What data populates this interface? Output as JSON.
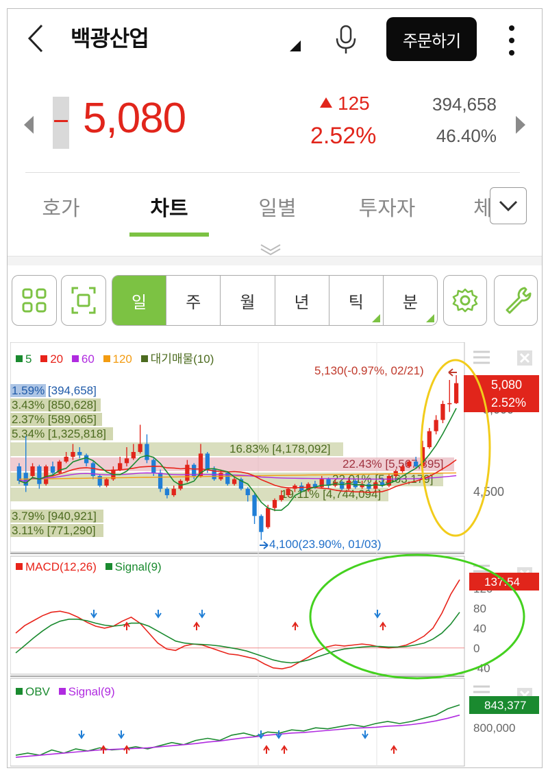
{
  "header": {
    "title": "백광산업",
    "order_button": "주문하기"
  },
  "quote": {
    "price": "5,080",
    "change": "125",
    "change_pct": "2.52%",
    "volume": "394,658",
    "turnover": "46.40%"
  },
  "tabs": [
    {
      "label": "호가"
    },
    {
      "label": "차트"
    },
    {
      "label": "일별"
    },
    {
      "label": "투자자"
    },
    {
      "label": "체"
    }
  ],
  "periods": [
    {
      "label": "일"
    },
    {
      "label": "주"
    },
    {
      "label": "월"
    },
    {
      "label": "년"
    },
    {
      "label": "틱"
    },
    {
      "label": "분"
    }
  ],
  "colors": {
    "up": "#e1251b",
    "down": "#1f7ed6",
    "accent": "#7cc243",
    "ma5": "#1a8a2f",
    "ma20": "#e8231a",
    "ma60": "#b02be0",
    "ma120": "#f39c12",
    "vp": "#4c6b1f"
  },
  "price_chart": {
    "legend": [
      {
        "label": "5",
        "color": "#1a8a2f"
      },
      {
        "label": "20",
        "color": "#e8231a"
      },
      {
        "label": "60",
        "color": "#b02be0"
      },
      {
        "label": "120",
        "color": "#f39c12"
      },
      {
        "label": "대기매물(10)",
        "color": "#4c6b1f"
      }
    ],
    "high_label": "5,130(-0.97%, 02/21)",
    "low_label": "4,100(23.90%, 01/03)",
    "axis_label": "4,500",
    "axis_label_top": "5,000",
    "tag_price": "5,080",
    "tag_pct": "2.52%",
    "volume_profile": [
      {
        "label": "1.59% [394,658]",
        "highlight": "blue"
      },
      {
        "label": "3.43% [850,628]"
      },
      {
        "label": "2.37% [589,065]"
      },
      {
        "label": "5.34% [1,325,818]"
      },
      {
        "label": "16.83% [4,178,092]"
      },
      {
        "label": "22.43% [5,567,895]",
        "highlight": "pink"
      },
      {
        "label": "22.01% [5,463,179]"
      },
      {
        "label": "19.11% [4,744,094]"
      },
      {
        "label": "3.79% [940,921]"
      },
      {
        "label": "3.11% [771,290]"
      }
    ]
  },
  "macd_chart": {
    "legend": [
      {
        "label": "MACD(12,26)",
        "color": "#e8231a"
      },
      {
        "label": "Signal(9)",
        "color": "#1a8a2f"
      }
    ],
    "y_ticks": [
      "120",
      "80",
      "40",
      "0",
      "-40"
    ],
    "tag": "137.54"
  },
  "obv_chart": {
    "legend": [
      {
        "label": "OBV",
        "color": "#1a8a2f"
      },
      {
        "label": "Signal(9)",
        "color": "#b02be0"
      }
    ],
    "y_ticks": [
      "800,000"
    ],
    "tag": "843,377"
  },
  "chart_data": [
    {
      "type": "candlestick",
      "title": "",
      "ylim": [
        4050,
        5250
      ],
      "candles": [
        {
          "o": 4560,
          "c": 4470,
          "h": 4580,
          "l": 4450
        },
        {
          "o": 4520,
          "c": 4440,
          "h": 4750,
          "l": 4400
        },
        {
          "o": 4500,
          "c": 4560,
          "h": 4580,
          "l": 4490
        },
        {
          "o": 4560,
          "c": 4450,
          "h": 4570,
          "l": 4420
        },
        {
          "o": 4450,
          "c": 4560,
          "h": 4570,
          "l": 4440
        },
        {
          "o": 4560,
          "c": 4520,
          "h": 4590,
          "l": 4510
        },
        {
          "o": 4520,
          "c": 4590,
          "h": 4600,
          "l": 4510
        },
        {
          "o": 4590,
          "c": 4620,
          "h": 4650,
          "l": 4580
        },
        {
          "o": 4620,
          "c": 4650,
          "h": 4700,
          "l": 4600
        },
        {
          "o": 4650,
          "c": 4630,
          "h": 4680,
          "l": 4610
        },
        {
          "o": 4630,
          "c": 4580,
          "h": 4640,
          "l": 4560
        },
        {
          "o": 4580,
          "c": 4500,
          "h": 4590,
          "l": 4480
        },
        {
          "o": 4500,
          "c": 4440,
          "h": 4510,
          "l": 4430
        },
        {
          "o": 4440,
          "c": 4480,
          "h": 4490,
          "l": 4430
        },
        {
          "o": 4480,
          "c": 4540,
          "h": 4560,
          "l": 4470
        },
        {
          "o": 4540,
          "c": 4580,
          "h": 4620,
          "l": 4530
        },
        {
          "o": 4580,
          "c": 4610,
          "h": 4680,
          "l": 4560
        },
        {
          "o": 4610,
          "c": 4650,
          "h": 4700,
          "l": 4600
        },
        {
          "o": 4650,
          "c": 4700,
          "h": 4820,
          "l": 4640
        },
        {
          "o": 4700,
          "c": 4600,
          "h": 4760,
          "l": 4580
        },
        {
          "o": 4600,
          "c": 4520,
          "h": 4610,
          "l": 4500
        },
        {
          "o": 4520,
          "c": 4420,
          "h": 4540,
          "l": 4400
        },
        {
          "o": 4420,
          "c": 4380,
          "h": 4430,
          "l": 4360
        },
        {
          "o": 4380,
          "c": 4420,
          "h": 4440,
          "l": 4370
        },
        {
          "o": 4420,
          "c": 4470,
          "h": 4480,
          "l": 4410
        },
        {
          "o": 4470,
          "c": 4570,
          "h": 4600,
          "l": 4460
        },
        {
          "o": 4570,
          "c": 4500,
          "h": 4580,
          "l": 4480
        },
        {
          "o": 4500,
          "c": 4640,
          "h": 4700,
          "l": 4490
        },
        {
          "o": 4640,
          "c": 4540,
          "h": 4650,
          "l": 4520
        },
        {
          "o": 4540,
          "c": 4480,
          "h": 4560,
          "l": 4470
        },
        {
          "o": 4480,
          "c": 4520,
          "h": 4540,
          "l": 4470
        },
        {
          "o": 4520,
          "c": 4450,
          "h": 4530,
          "l": 4440
        },
        {
          "o": 4450,
          "c": 4480,
          "h": 4500,
          "l": 4440
        },
        {
          "o": 4480,
          "c": 4420,
          "h": 4490,
          "l": 4410
        },
        {
          "o": 4420,
          "c": 4380,
          "h": 4430,
          "l": 4340
        },
        {
          "o": 4380,
          "c": 4250,
          "h": 4390,
          "l": 4200
        },
        {
          "o": 4250,
          "c": 4150,
          "h": 4260,
          "l": 4100
        },
        {
          "o": 4180,
          "c": 4300,
          "h": 4320,
          "l": 4170
        },
        {
          "o": 4300,
          "c": 4350,
          "h": 4360,
          "l": 4280
        },
        {
          "o": 4350,
          "c": 4380,
          "h": 4410,
          "l": 4340
        },
        {
          "o": 4380,
          "c": 4420,
          "h": 4430,
          "l": 4370
        },
        {
          "o": 4420,
          "c": 4440,
          "h": 4450,
          "l": 4400
        },
        {
          "o": 4440,
          "c": 4410,
          "h": 4460,
          "l": 4400
        },
        {
          "o": 4410,
          "c": 4450,
          "h": 4460,
          "l": 4400
        },
        {
          "o": 4450,
          "c": 4430,
          "h": 4470,
          "l": 4420
        },
        {
          "o": 4430,
          "c": 4480,
          "h": 4500,
          "l": 4420
        },
        {
          "o": 4480,
          "c": 4440,
          "h": 4490,
          "l": 4420
        },
        {
          "o": 4440,
          "c": 4460,
          "h": 4480,
          "l": 4430
        },
        {
          "o": 4460,
          "c": 4420,
          "h": 4470,
          "l": 4410
        },
        {
          "o": 4420,
          "c": 4470,
          "h": 4490,
          "l": 4410
        },
        {
          "o": 4470,
          "c": 4430,
          "h": 4480,
          "l": 4420
        },
        {
          "o": 4430,
          "c": 4450,
          "h": 4470,
          "l": 4420
        },
        {
          "o": 4450,
          "c": 4420,
          "h": 4460,
          "l": 4410
        },
        {
          "o": 4420,
          "c": 4460,
          "h": 4470,
          "l": 4410
        },
        {
          "o": 4460,
          "c": 4440,
          "h": 4490,
          "l": 4430
        },
        {
          "o": 4440,
          "c": 4500,
          "h": 4510,
          "l": 4430
        },
        {
          "o": 4500,
          "c": 4530,
          "h": 4540,
          "l": 4490
        },
        {
          "o": 4530,
          "c": 4560,
          "h": 4570,
          "l": 4520
        },
        {
          "o": 4560,
          "c": 4590,
          "h": 4600,
          "l": 4550
        },
        {
          "o": 4590,
          "c": 4560,
          "h": 4620,
          "l": 4550
        },
        {
          "o": 4560,
          "c": 4680,
          "h": 4720,
          "l": 4550
        },
        {
          "o": 4680,
          "c": 4780,
          "h": 4800,
          "l": 4670
        },
        {
          "o": 4780,
          "c": 4850,
          "h": 4880,
          "l": 4760
        },
        {
          "o": 4850,
          "c": 4950,
          "h": 4970,
          "l": 4830
        },
        {
          "o": 4950,
          "c": 4955,
          "h": 5100,
          "l": 4900
        },
        {
          "o": 4955,
          "c": 5080,
          "h": 5130,
          "l": 4950
        }
      ]
    },
    {
      "type": "line",
      "title": "",
      "ylim": [
        -50,
        160
      ],
      "series": [
        {
          "name": "MACD(12,26)",
          "values": [
            30,
            45,
            55,
            65,
            72,
            74,
            70,
            62,
            52,
            44,
            40,
            44,
            54,
            62,
            50,
            30,
            10,
            -2,
            -5,
            4,
            8,
            6,
            0,
            -6,
            -12,
            -14,
            -18,
            -22,
            -32,
            -40,
            -42,
            -38,
            -28,
            -18,
            -6,
            2,
            6,
            4,
            6,
            8,
            6,
            2,
            0,
            2,
            6,
            14,
            24,
            40,
            70,
            108,
            137.54
          ]
        },
        {
          "name": "Signal(9)",
          "values": [
            -10,
            5,
            20,
            34,
            46,
            54,
            58,
            58,
            55,
            50,
            46,
            44,
            46,
            50,
            50,
            44,
            34,
            24,
            14,
            10,
            8,
            7,
            6,
            4,
            1,
            -2,
            -6,
            -12,
            -18,
            -24,
            -28,
            -30,
            -28,
            -24,
            -18,
            -12,
            -6,
            -2,
            0,
            2,
            3,
            3,
            2,
            2,
            3,
            6,
            10,
            18,
            30,
            48,
            72
          ]
        }
      ]
    },
    {
      "type": "line",
      "title": "",
      "ylim": [
        730000,
        860000
      ],
      "series": [
        {
          "name": "OBV",
          "values": [
            748000,
            752000,
            748000,
            758000,
            752000,
            760000,
            756000,
            762000,
            758000,
            760000,
            764000,
            760000,
            766000,
            772000,
            768000,
            776000,
            780000,
            776000,
            786000,
            790000,
            784000,
            792000,
            790000,
            796000,
            794000,
            800000,
            798000,
            802000,
            806000,
            802000,
            808000,
            812000,
            808000,
            812000,
            818000,
            824000,
            836000,
            843377
          ]
        },
        {
          "name": "Signal(9)",
          "values": [
            744000,
            746000,
            748000,
            750000,
            752000,
            754000,
            756000,
            758000,
            759000,
            760000,
            761000,
            762000,
            764000,
            766000,
            768000,
            770000,
            773000,
            775000,
            778000,
            781000,
            783000,
            786000,
            788000,
            790000,
            791000,
            793000,
            795000,
            797000,
            799000,
            800000,
            801000,
            803000,
            804000,
            806000,
            809000,
            813000,
            818000,
            824000
          ]
        }
      ]
    }
  ]
}
